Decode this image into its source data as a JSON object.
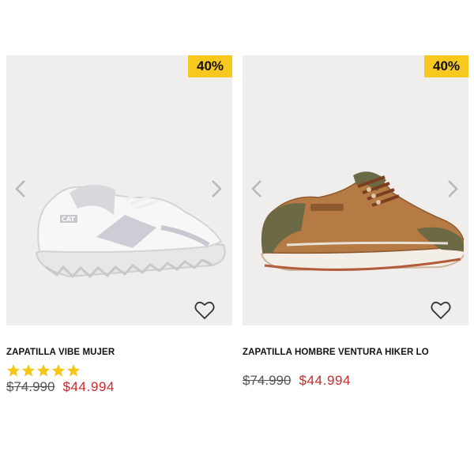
{
  "products": [
    {
      "name": "ZAPATILLA VIBE MUJER",
      "discount_badge": "40%",
      "old_price": "$74.990",
      "price": "$44.994",
      "rating_stars": 5,
      "icons": {
        "prev": "chevron-left-icon",
        "next": "chevron-right-icon",
        "favorite": "heart-icon"
      },
      "colors": {
        "badge": "#f7c81d",
        "price": "#c62a2f"
      }
    },
    {
      "name": "ZAPATILLA HOMBRE VENTURA HIKER LO",
      "discount_badge": "40%",
      "old_price": "$74.990",
      "price": "$44.994",
      "icons": {
        "prev": "chevron-left-icon",
        "next": "chevron-right-icon",
        "favorite": "heart-icon"
      },
      "colors": {
        "badge": "#f7c81d",
        "price": "#c62a2f"
      }
    }
  ]
}
